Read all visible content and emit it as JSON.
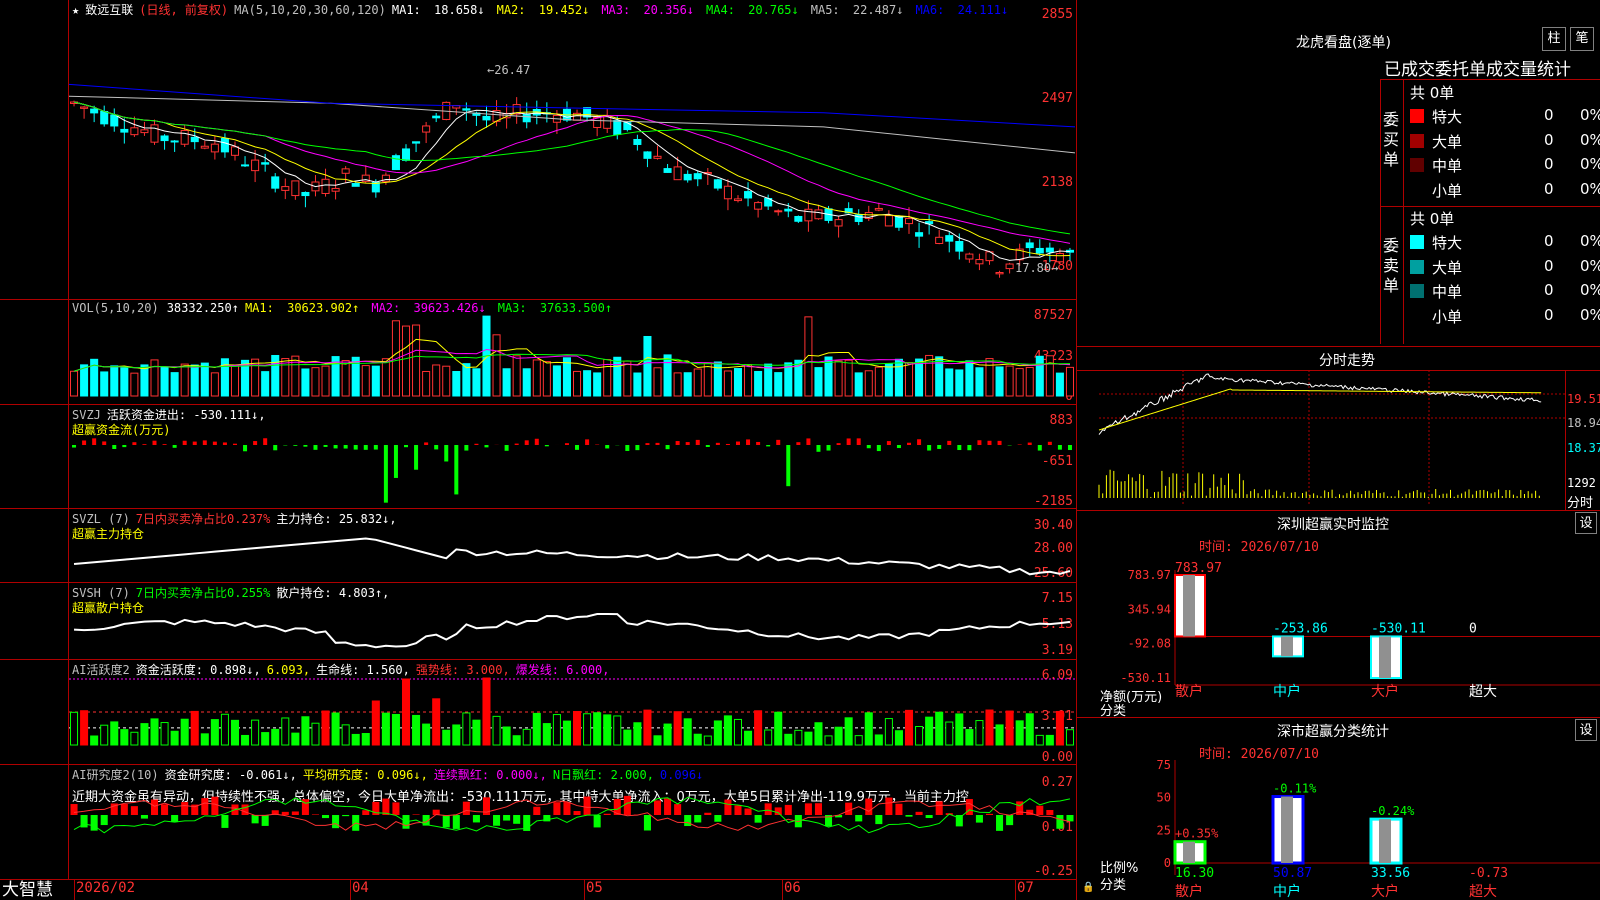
{
  "app": {
    "name": "大智慧"
  },
  "stock": {
    "name": "致远互联",
    "period_label": "(日线, 前复权)"
  },
  "colors": {
    "up": "#ff3232",
    "down": "#00ffff",
    "grid": "#b00000",
    "axis_text": "#ff3232",
    "ma1": "#ffffff",
    "ma2": "#ffff00",
    "ma3": "#ff00ff",
    "ma4": "#00ff00",
    "ma5": "#c0c0c0",
    "ma6": "#0000ff"
  },
  "price_pane": {
    "ma_header": "MA(5,10,20,30,60,120)",
    "ma": [
      {
        "label": "MA1:",
        "value": "18.658↓"
      },
      {
        "label": "MA2:",
        "value": "19.452↓"
      },
      {
        "label": "MA3:",
        "value": "20.356↓"
      },
      {
        "label": "MA4:",
        "value": "20.765↓"
      },
      {
        "label": "MA5:",
        "value": "22.487↓"
      },
      {
        "label": "MA6:",
        "value": "24.111↓"
      }
    ],
    "y_ticks": [
      "2855",
      "2497",
      "2138",
      "1780"
    ],
    "high_marker": "26.47",
    "low_marker": "17.80"
  },
  "vol_pane": {
    "header": "VOL(5,10,20)",
    "value": "38332.250↑",
    "ma": [
      {
        "label": "MA1:",
        "value": "30623.902↑"
      },
      {
        "label": "MA2:",
        "value": "39623.426↓"
      },
      {
        "label": "MA3:",
        "value": "37633.500↑"
      }
    ],
    "y_ticks": [
      "87527",
      "43223",
      "0"
    ]
  },
  "svzj_pane": {
    "header": "SVZJ",
    "line1": "活跃资金进出: -530.111↓,",
    "line2": "超赢资金流(万元)",
    "y_ticks": [
      "883",
      "-651",
      "-2185"
    ]
  },
  "svzl_pane": {
    "header": "SVZL (7)",
    "ratio": "7日内买卖净占比0.237%",
    "holding": "主力持仓: 25.832↓,",
    "line2": "超赢主力持仓",
    "y_ticks": [
      "30.40",
      "28.00",
      "25.60"
    ]
  },
  "svsh_pane": {
    "header": "SVSH (7)",
    "ratio": "7日内买卖净占比0.255%",
    "holding": "散户持仓: 4.803↑,",
    "line2": "超赢散户持仓",
    "y_ticks": [
      "7.15",
      "5.13",
      "3.19"
    ]
  },
  "ai_active_pane": {
    "header": "AI活跃度2",
    "fund_active": "资金活跃度: 0.898↓,",
    "v2": "6.093,",
    "life_line": "生命线: 1.560,",
    "strong_line": "强势线: 3.000,",
    "burst_line": "爆发线: 6.000,",
    "y_ticks": [
      "6.09",
      "3.01",
      "0.00"
    ]
  },
  "ai_research_pane": {
    "header": "AI研究度2(10)",
    "research": "资金研究度: -0.061↓,",
    "avg": "平均研究度: 0.096↓,",
    "consec": "连续飘红: 0.000↓,",
    "nday": "N日飘红: 2.000,",
    "last": "0.096↓",
    "commentary": "近期大资金虽有异动，但持续性不强，总体偏空，今日大单净流出：-530.111万元，其中特大单净流入：0万元，大单5日累计净出-119.9万元，当前主力控",
    "y_ticks": [
      "0.27",
      "0.01",
      "-0.25"
    ]
  },
  "x_axis": {
    "labels": [
      "2026/02",
      "04",
      "05",
      "06",
      "07"
    ]
  },
  "dragon_tiger": {
    "title": "龙虎看盘(逐单)",
    "btn_bar": "柱",
    "btn_pen": "笔",
    "subtitle": "已成交委托单成交量统计",
    "buy_label": "委买单",
    "sell_label": "委卖单",
    "buy_total": "共 0单",
    "sell_total": "共 0单",
    "buy_rows": [
      {
        "label": "特大",
        "count": "0",
        "pct": "0%",
        "color": "#ff0000"
      },
      {
        "label": "大单",
        "count": "0",
        "pct": "0%",
        "color": "#a00000"
      },
      {
        "label": "中单",
        "count": "0",
        "pct": "0%",
        "color": "#600000"
      },
      {
        "label": "小单",
        "count": "0",
        "pct": "0%",
        "color": "#000000"
      }
    ],
    "sell_rows": [
      {
        "label": "特大",
        "count": "0",
        "pct": "0%",
        "color": "#00ffff"
      },
      {
        "label": "大单",
        "count": "0",
        "pct": "0%",
        "color": "#00a0a0"
      },
      {
        "label": "中单",
        "count": "0",
        "pct": "0%",
        "color": "#007070"
      },
      {
        "label": "小单",
        "count": "0",
        "pct": "0%",
        "color": "#000000"
      }
    ]
  },
  "intraday": {
    "title": "分时走势",
    "y_ticks": [
      "19.51",
      "18.94",
      "18.37"
    ],
    "vol_tick": "1292",
    "vol_label": "分时"
  },
  "sz_monitor": {
    "title": "深圳超赢实时监控",
    "btn": "设",
    "time": "时间: 2026/07/10",
    "y_ticks": [
      "783.97",
      "345.94",
      "-92.08",
      "-530.11"
    ],
    "axis_label1": "净额(万元)",
    "axis_label2": "分类",
    "cats": [
      "散户",
      "中户",
      "大户",
      "超大"
    ],
    "values": [
      783.97,
      -253.86,
      -530.11,
      0
    ],
    "value_labels": [
      "783.97",
      "-253.86",
      "-530.11",
      "0"
    ]
  },
  "sz_classify": {
    "title": "深市超赢分类统计",
    "btn": "设",
    "time": "时间: 2026/07/10",
    "y_ticks": [
      "75",
      "50",
      "25",
      "0"
    ],
    "axis_label1": "比例%",
    "axis_label2": "分类",
    "cats": [
      "散户",
      "中户",
      "大户",
      "超大"
    ],
    "values": [
      16.3,
      50.87,
      33.56,
      -0.73
    ],
    "value_labels": [
      "16.30",
      "50.87",
      "33.56",
      "-0.73"
    ],
    "change_labels": [
      "+0.35%",
      "-0.11%",
      "-0.24%",
      ""
    ]
  }
}
